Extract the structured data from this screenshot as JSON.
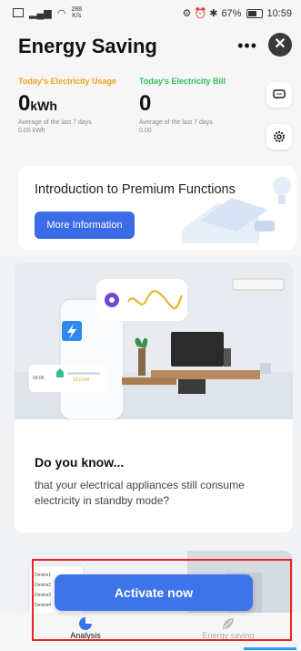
{
  "status": {
    "net_speed": "288",
    "net_unit": "K/s",
    "battery": "67%",
    "time": "10:59"
  },
  "header": {
    "title": "Energy Saving",
    "more_icon": "more-dots-icon",
    "close_icon": "close-icon"
  },
  "stats": {
    "usage_label": "Today's Electricity Usage",
    "usage_value": "0",
    "usage_unit": "kWh",
    "usage_sub1": "Average of the last 7 days",
    "usage_sub2": "0.00 kWh",
    "bill_label": "Today's Electricity Bill",
    "bill_value": "0",
    "bill_sub1": "Average of the last 7 days",
    "bill_sub2": "0.00",
    "usage_color": "#f0a21a",
    "bill_color": "#2fbf5a"
  },
  "premium": {
    "title": "Introduction to Premium Functions",
    "button": "More Information"
  },
  "tip_card": {
    "scene_time": "09:06",
    "scene_value": "33.0",
    "scene_unit": "kW",
    "title": "Do you know...",
    "text": "that your electrical appliances still consume electricity in standby mode?"
  },
  "card2": {
    "devices": [
      "Device1",
      "Device2",
      "Device3",
      "Device4"
    ]
  },
  "cta": {
    "label": "Activate now"
  },
  "tabs": [
    {
      "label": "Analysis",
      "icon": "pie-chart-icon"
    },
    {
      "label": "Energy saving",
      "icon": "leaf-icon"
    }
  ]
}
